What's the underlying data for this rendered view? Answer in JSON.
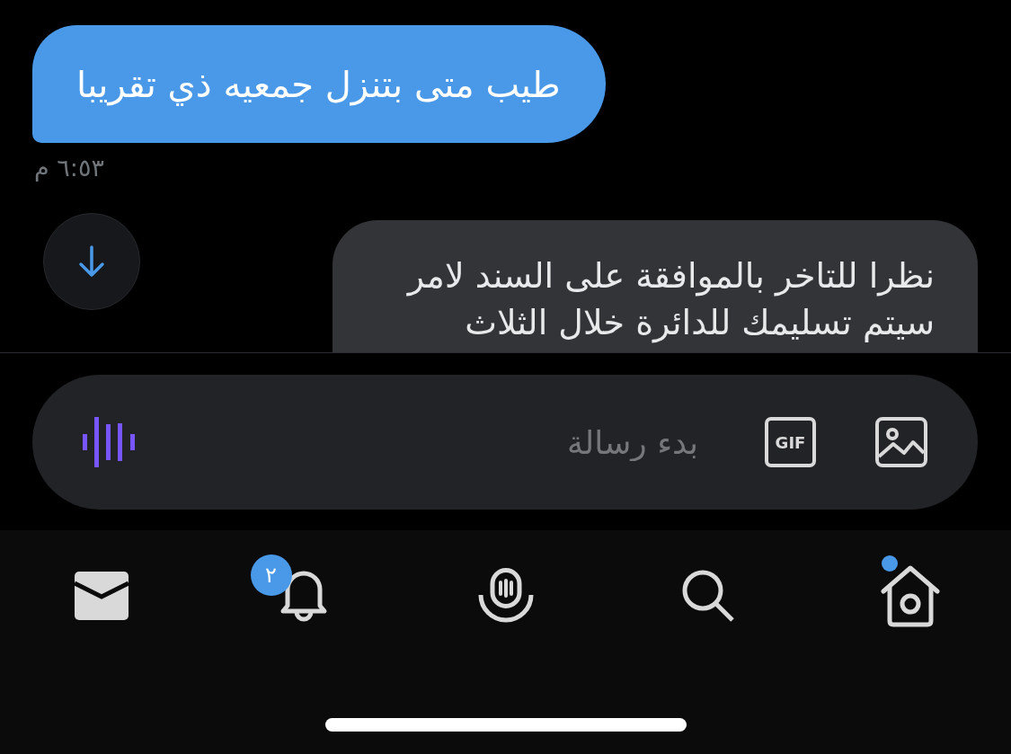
{
  "messages": [
    {
      "kind": "sent",
      "lines": [
        "طيب متى بتنزل جمعيه ذي تقريبا"
      ],
      "time": "٦:٥٣ م"
    },
    {
      "kind": "received",
      "lines": [
        "نظرا للتاخر بالموافقة على السند لامر",
        "سيتم تسليمك للدائرة خلال الثلاث"
      ]
    }
  ],
  "composer": {
    "placeholder": "بدء رسالة",
    "gif_label": "GIF"
  },
  "tab_bar": {
    "tabs": [
      {
        "kind": "home",
        "selected": false,
        "new_dot": true
      },
      {
        "kind": "search",
        "selected": false
      },
      {
        "kind": "spaces",
        "selected": false
      },
      {
        "kind": "notifications",
        "selected": false,
        "badge": "٢"
      },
      {
        "kind": "messages",
        "selected": true
      }
    ]
  }
}
